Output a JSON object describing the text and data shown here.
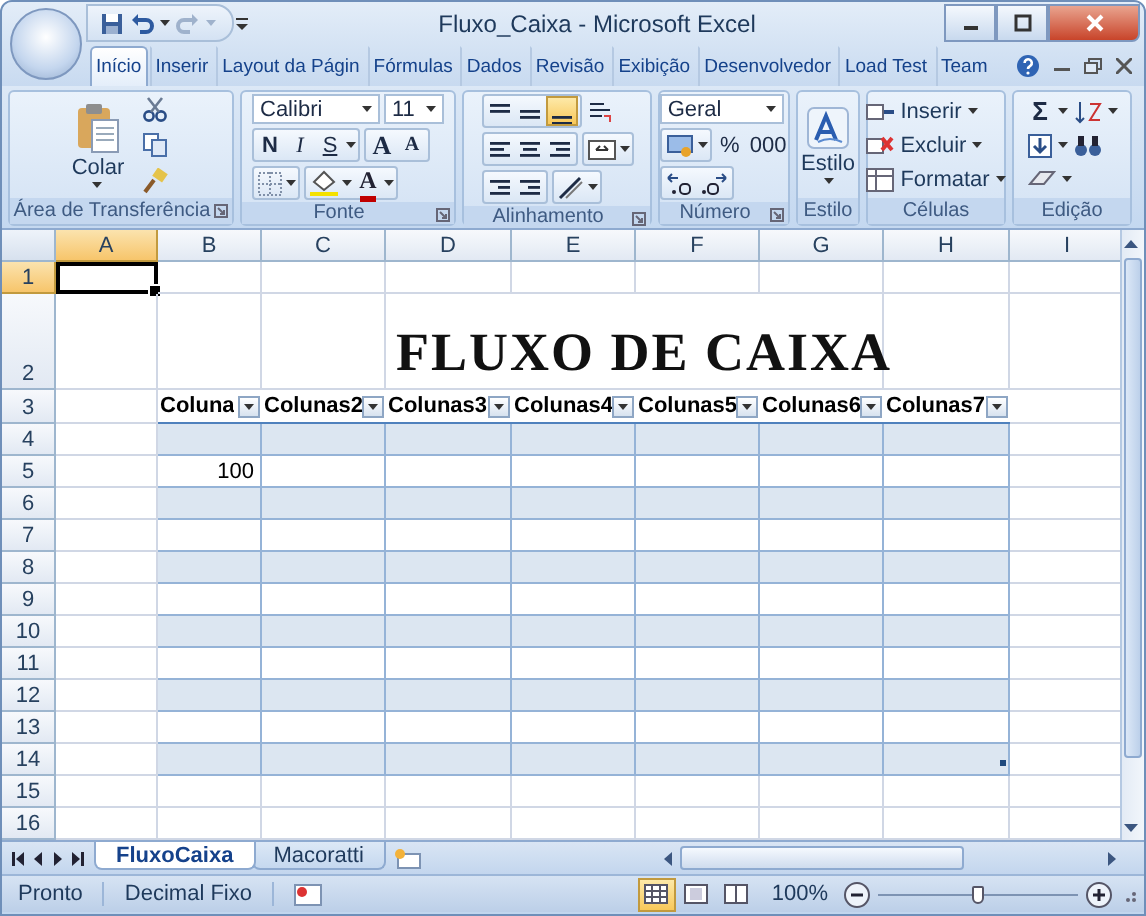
{
  "window": {
    "title": "Fluxo_Caixa - Microsoft Excel"
  },
  "ribbon": {
    "tabs": [
      {
        "label": "Início",
        "selected": true
      },
      {
        "label": "Inserir",
        "selected": false
      },
      {
        "label": "Layout da Págin",
        "selected": false
      },
      {
        "label": "Fórmulas",
        "selected": false
      },
      {
        "label": "Dados",
        "selected": false
      },
      {
        "label": "Revisão",
        "selected": false
      },
      {
        "label": "Exibição",
        "selected": false
      },
      {
        "label": "Desenvolvedor",
        "selected": false
      },
      {
        "label": "Load Test",
        "selected": false
      },
      {
        "label": "Team",
        "selected": false
      }
    ],
    "groups": [
      {
        "kind": "clipboard",
        "label": "Área de Transferência",
        "paste": "Colar"
      },
      {
        "kind": "font",
        "label": "Fonte",
        "font_name": "Calibri",
        "font_size": "11",
        "bold": "N",
        "italic": "I",
        "underline": "S",
        "grow": "A",
        "shrink": "A",
        "font_color": "A"
      },
      {
        "kind": "alignment",
        "label": "Alinhamento",
        "vertical_align": [
          {
            "selected": false
          },
          {
            "selected": false
          },
          {
            "selected": true
          }
        ]
      },
      {
        "kind": "number",
        "label": "Número",
        "format": "Geral",
        "percent": "%",
        "thousands": "000"
      },
      {
        "kind": "style",
        "label": "Estilo",
        "button": "Estilo"
      },
      {
        "kind": "cells",
        "label": "Células",
        "buttons": [
          "Inserir",
          "Excluir",
          "Formatar"
        ]
      },
      {
        "kind": "editing",
        "label": "Edição",
        "sum": "Σ"
      }
    ]
  },
  "sheet": {
    "columns": [
      {
        "label": "A",
        "selected": true
      },
      {
        "label": "B",
        "selected": false
      },
      {
        "label": "C",
        "selected": false
      },
      {
        "label": "D",
        "selected": false
      },
      {
        "label": "E",
        "selected": false
      },
      {
        "label": "F",
        "selected": false
      },
      {
        "label": "G",
        "selected": false
      },
      {
        "label": "H",
        "selected": false
      },
      {
        "label": "I",
        "selected": false
      }
    ],
    "rows": [
      {
        "label": "1",
        "selected": true
      },
      {
        "label": "2",
        "selected": false
      },
      {
        "label": "3",
        "selected": false
      },
      {
        "label": "4",
        "selected": false
      },
      {
        "label": "5",
        "selected": false
      },
      {
        "label": "6",
        "selected": false
      },
      {
        "label": "7",
        "selected": false
      },
      {
        "label": "8",
        "selected": false
      },
      {
        "label": "9",
        "selected": false
      },
      {
        "label": "10",
        "selected": false
      },
      {
        "label": "11",
        "selected": false
      },
      {
        "label": "12",
        "selected": false
      },
      {
        "label": "13",
        "selected": false
      },
      {
        "label": "14",
        "selected": false
      },
      {
        "label": "15",
        "selected": false
      },
      {
        "label": "16",
        "selected": false
      }
    ],
    "title": "FLUXO DE CAIXA",
    "table": {
      "headers": [
        "Coluna",
        "Colunas2",
        "Colunas3",
        "Colunas4",
        "Colunas5",
        "Colunas6",
        "Colunas7"
      ],
      "rows": [
        {
          "banded": true
        },
        {
          "banded": false,
          "values": [
            "100"
          ]
        },
        {
          "banded": true
        },
        {
          "banded": false
        },
        {
          "banded": true
        },
        {
          "banded": false
        },
        {
          "banded": true
        },
        {
          "banded": false
        },
        {
          "banded": true
        },
        {
          "banded": false
        },
        {
          "banded": true
        }
      ]
    }
  },
  "sheet_tabs": [
    {
      "label": "FluxoCaixa",
      "selected": true
    },
    {
      "label": "Macoratti",
      "selected": false
    }
  ],
  "status_bar": {
    "items": [
      "Pronto",
      "Decimal Fixo"
    ],
    "views": [
      {
        "selected": true
      },
      {
        "selected": false
      },
      {
        "selected": false
      }
    ],
    "zoom": "100%",
    "zoom_slider": {
      "level": 0.5
    }
  }
}
